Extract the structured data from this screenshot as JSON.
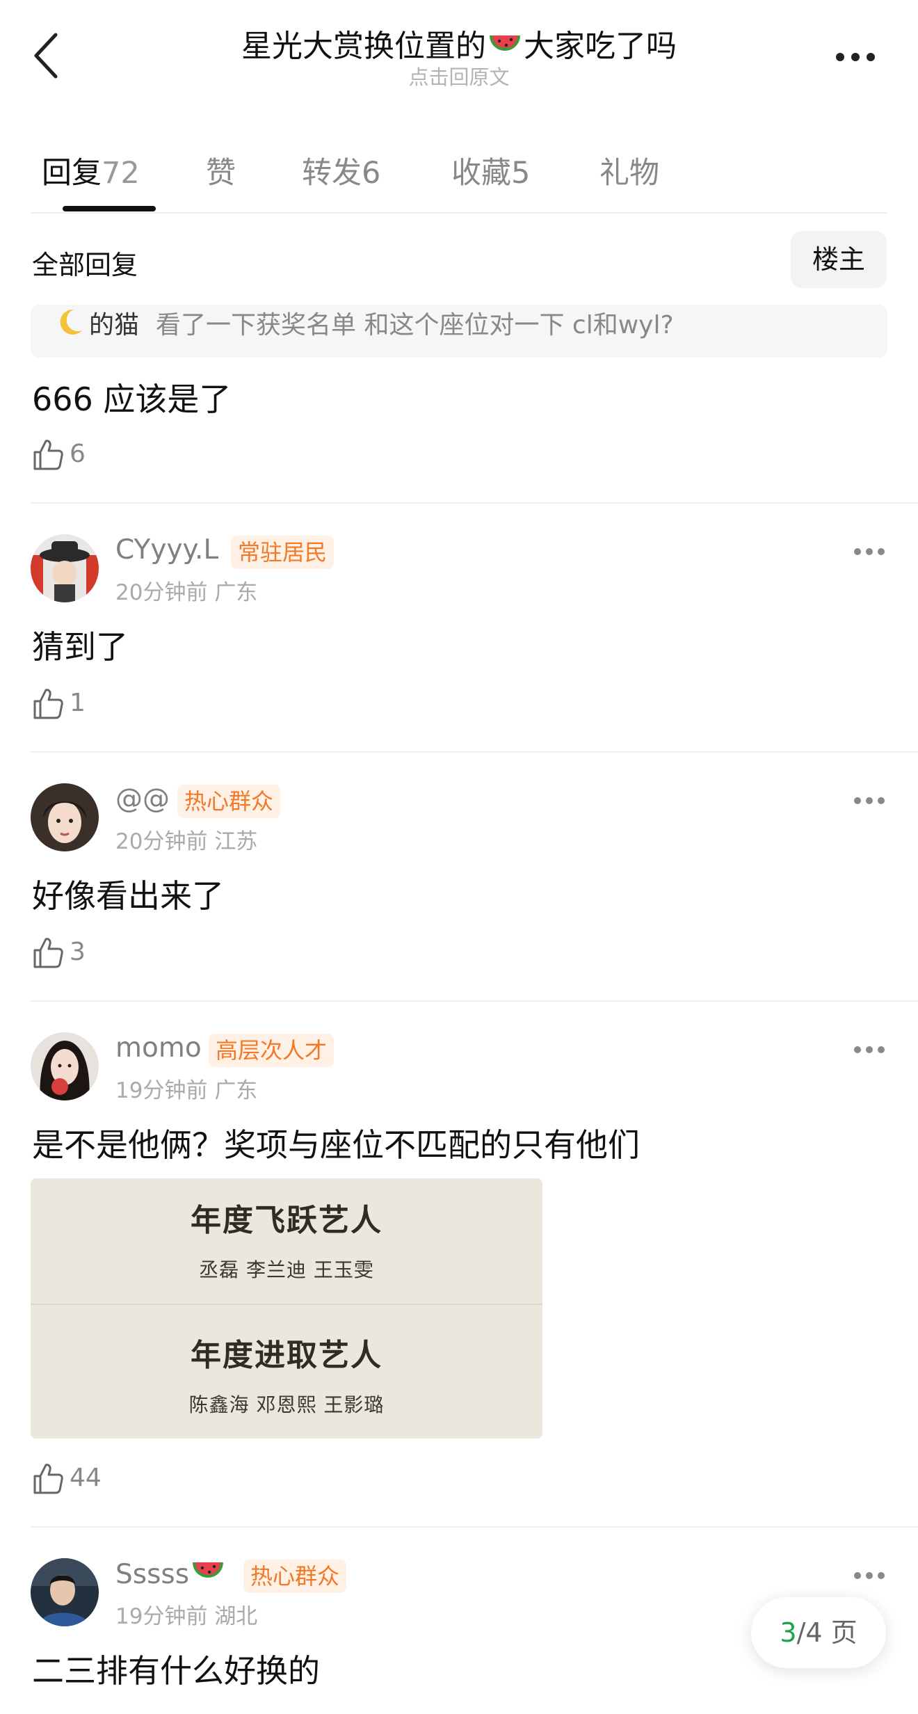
{
  "header": {
    "title_before": "星光大赏换位置的",
    "title_after": "大家吃了吗",
    "subtitle": "点击回原文"
  },
  "tabs": [
    {
      "label": "回复",
      "count": "72"
    },
    {
      "label": "赞",
      "count": ""
    },
    {
      "label": "转发",
      "count": "6"
    },
    {
      "label": "收藏",
      "count": "5"
    },
    {
      "label": "礼物",
      "count": ""
    }
  ],
  "filter": {
    "all_replies": "全部回复",
    "owner_button": "楼主"
  },
  "quoted": {
    "name": "的猫",
    "text": "看了一下获奖名单 和这个座位对一下 cl和wyl?"
  },
  "first_comment": {
    "text": "666 应该是了",
    "likes": "6"
  },
  "comments": [
    {
      "name": "CYyyy.L",
      "badge": "常驻居民",
      "time": "20分钟前",
      "location": "广东",
      "text": "猜到了",
      "likes": "1"
    },
    {
      "name": "@@",
      "badge": "热心群众",
      "time": "20分钟前",
      "location": "江苏",
      "text": "好像看出来了",
      "likes": "3"
    },
    {
      "name": "momo",
      "badge": "高层次人才",
      "time": "19分钟前",
      "location": "广东",
      "text": "是不是他俩？奖项与座位不匹配的只有他们",
      "likes": "44"
    },
    {
      "name": "Sssss",
      "badge": "热心群众",
      "time": "19分钟前",
      "location": "湖北",
      "text": "二三排有什么好换的",
      "likes": ""
    }
  ],
  "attached_image": {
    "title1": "年度飞跃艺人",
    "names1": "丞磊  李兰迪  王玉雯",
    "title2": "年度进取艺人",
    "names2": "陈鑫海  邓恩熙  王影璐"
  },
  "pager": {
    "current": "3",
    "total_text": "/4 页"
  },
  "icons": {
    "back": "back-arrow-icon",
    "more": "more-dots-icon",
    "like": "thumbs-up-icon",
    "moon": "moon-emoji-icon",
    "watermelon": "watermelon-emoji-icon"
  }
}
